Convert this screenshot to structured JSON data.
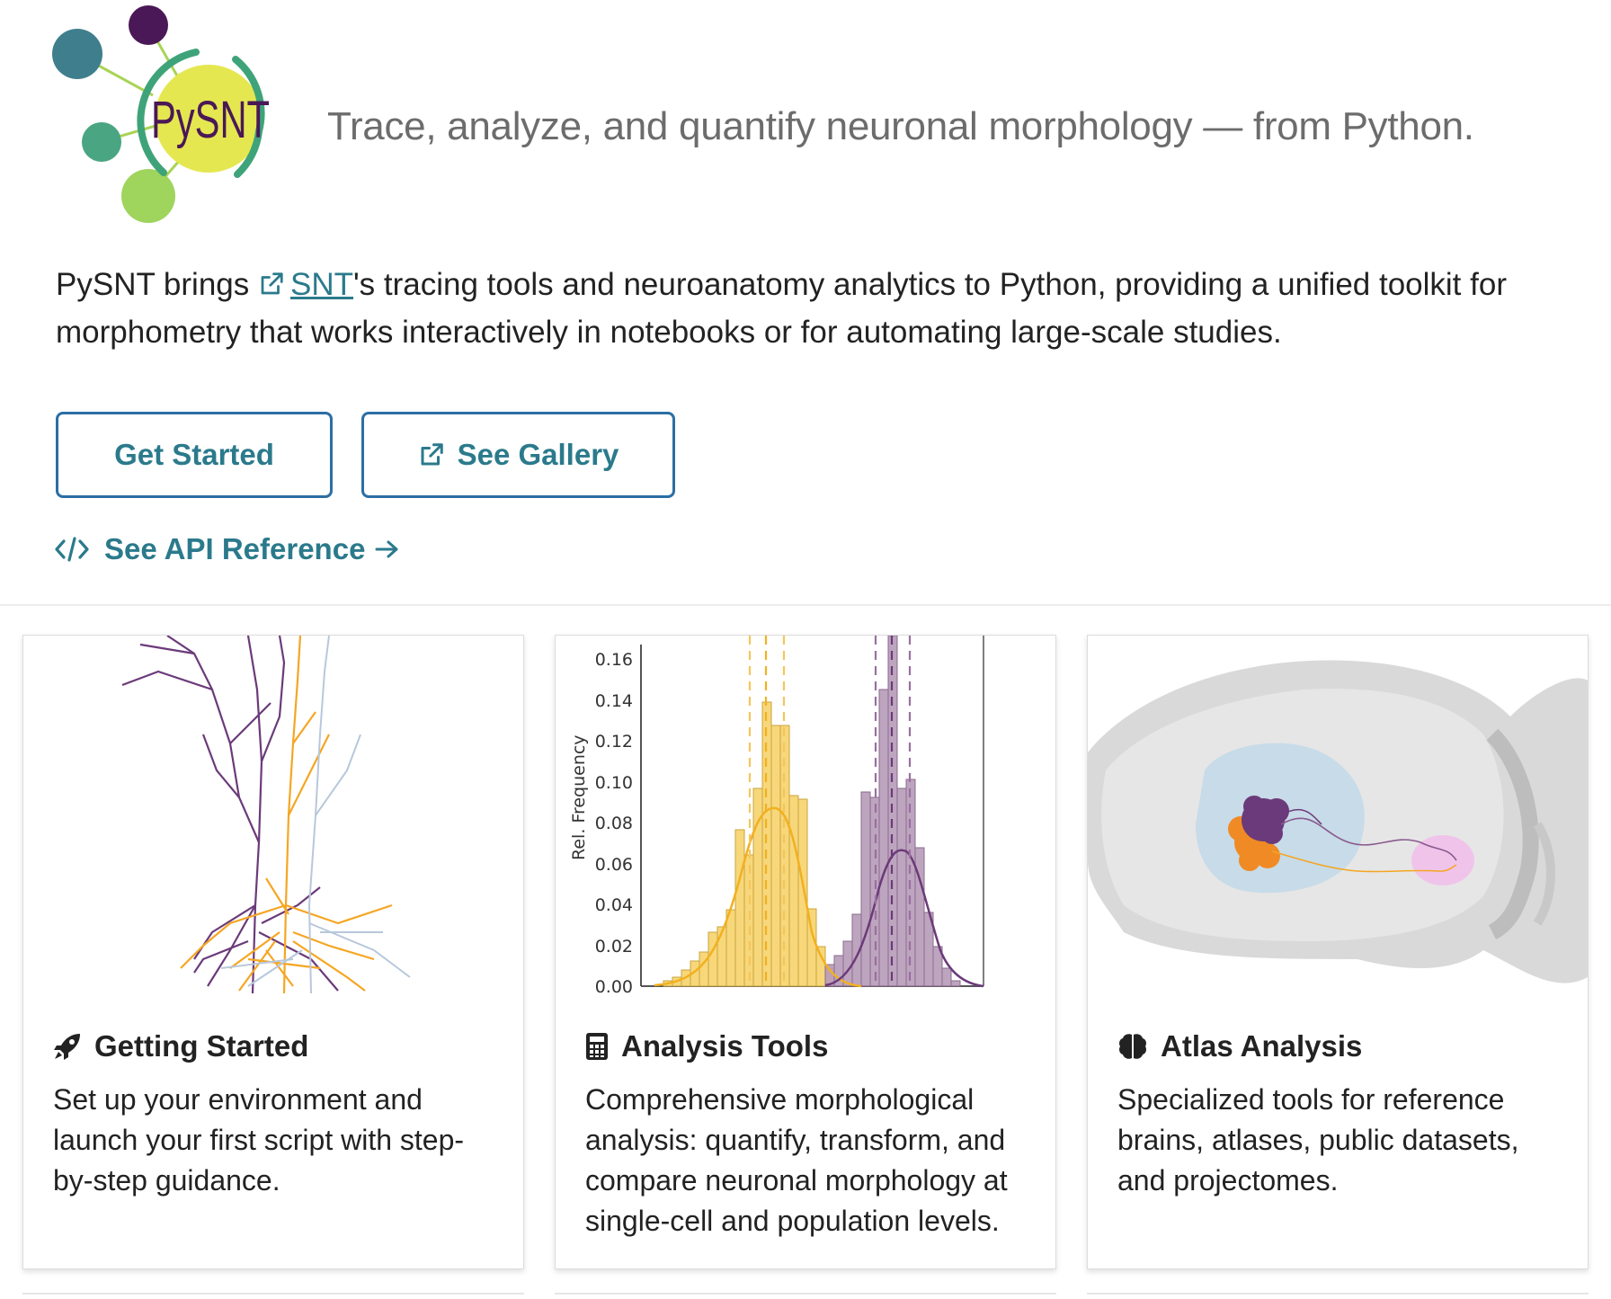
{
  "header": {
    "logo_text": "PySNT",
    "tagline": "Trace, analyze, and quantify neuronal morphology — from Python."
  },
  "intro": {
    "prefix": "PySNT brings ",
    "link_text": "SNT",
    "suffix": "'s tracing tools and neuroanatomy analytics to Python, providing a unified toolkit for morphometry that works interactively in notebooks or for automating large-scale studies."
  },
  "actions": {
    "get_started": "Get Started",
    "see_gallery": "See Gallery",
    "api_reference": "See API Reference"
  },
  "cards": [
    {
      "title": "Getting Started",
      "icon": "rocket-icon",
      "text": "Set up your environment and launch your first script with step-by-step guidance."
    },
    {
      "title": "Analysis Tools",
      "icon": "calculator-icon",
      "text": "Comprehensive morphological analysis: quantify, transform, and compare neuronal morphology at single-cell and population levels."
    },
    {
      "title": "Atlas Analysis",
      "icon": "brain-icon",
      "text": "Specialized tools for reference brains, atlases, public datasets, and projectomes."
    }
  ],
  "histogram": {
    "ylabel": "Rel. Frequency",
    "yticks": [
      "0.16",
      "0.14",
      "0.12",
      "0.10",
      "0.08",
      "0.06",
      "0.04",
      "0.02",
      "0.00"
    ]
  },
  "colors": {
    "accent": "#2b7a8c",
    "button_border": "#2c6ea4",
    "orange": "#f5a623",
    "purple": "#6b3a7a",
    "yellow_bar": "#f7d77a",
    "purple_bar": "#b79bb8"
  }
}
